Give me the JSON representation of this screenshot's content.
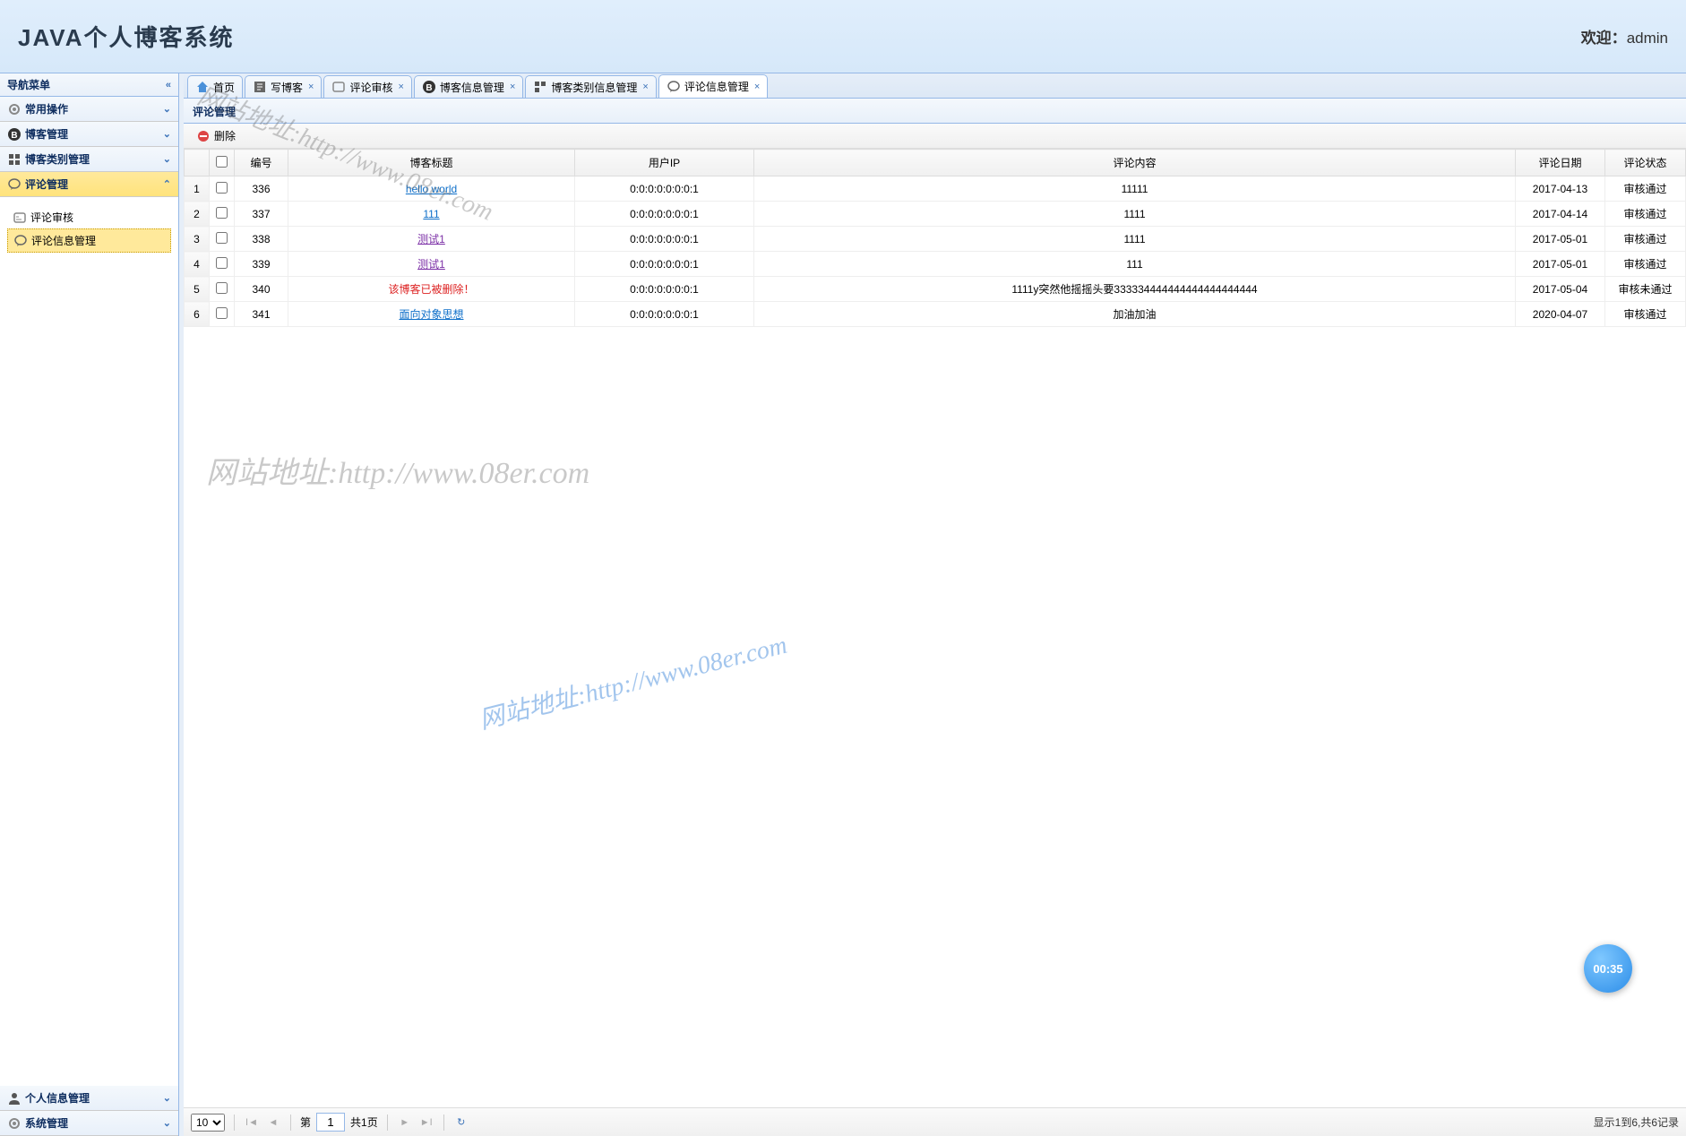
{
  "header": {
    "logo": "JAVA个人博客系统",
    "welcome_label": "欢迎：",
    "username": "admin"
  },
  "sidebar": {
    "title": "导航菜单",
    "sections": [
      {
        "label": "常用操作",
        "icon": "gear"
      },
      {
        "label": "博客管理",
        "icon": "blog"
      },
      {
        "label": "博客类别管理",
        "icon": "category"
      },
      {
        "label": "评论管理",
        "icon": "comment",
        "active": true
      },
      {
        "label": "个人信息管理",
        "icon": "user"
      },
      {
        "label": "系统管理",
        "icon": "settings"
      }
    ],
    "tree_items": [
      {
        "label": "评论审核",
        "icon": "review"
      },
      {
        "label": "评论信息管理",
        "icon": "comment",
        "selected": true
      }
    ]
  },
  "tabs": [
    {
      "label": "首页",
      "icon": "home",
      "closable": false
    },
    {
      "label": "写博客",
      "icon": "write",
      "closable": true
    },
    {
      "label": "评论审核",
      "icon": "review",
      "closable": true
    },
    {
      "label": "博客信息管理",
      "icon": "blog",
      "closable": true
    },
    {
      "label": "博客类别信息管理",
      "icon": "category",
      "closable": true
    },
    {
      "label": "评论信息管理",
      "icon": "comment",
      "closable": true,
      "active": true
    }
  ],
  "panel": {
    "title": "评论管理",
    "toolbar": {
      "delete_label": "删除"
    },
    "columns": [
      "编号",
      "博客标题",
      "用户IP",
      "评论内容",
      "评论日期",
      "评论状态"
    ],
    "rows": [
      {
        "num": "1",
        "id": "336",
        "title": "hello world",
        "title_class": "link-cell",
        "ip": "0:0:0:0:0:0:0:1",
        "content": "11111",
        "date": "2017-04-13",
        "status": "审核通过"
      },
      {
        "num": "2",
        "id": "337",
        "title": "111",
        "title_class": "link-cell",
        "ip": "0:0:0:0:0:0:0:1",
        "content": "1111",
        "date": "2017-04-14",
        "status": "审核通过"
      },
      {
        "num": "3",
        "id": "338",
        "title": "测试1",
        "title_class": "link-cell visited",
        "ip": "0:0:0:0:0:0:0:1",
        "content": "1111",
        "date": "2017-05-01",
        "status": "审核通过"
      },
      {
        "num": "4",
        "id": "339",
        "title": "测试1",
        "title_class": "link-cell visited",
        "ip": "0:0:0:0:0:0:0:1",
        "content": "111",
        "date": "2017-05-01",
        "status": "审核通过"
      },
      {
        "num": "5",
        "id": "340",
        "title": "该博客已被删除！",
        "title_class": "deleted",
        "ip": "0:0:0:0:0:0:0:1",
        "content": "1111y突然他摇摇头要333334444444444444444444",
        "date": "2017-05-04",
        "status": "审核未通过"
      },
      {
        "num": "6",
        "id": "341",
        "title": "面向对象思想",
        "title_class": "link-cell",
        "ip": "0:0:0:0:0:0:0:1",
        "content": "加油加油",
        "date": "2020-04-07",
        "status": "审核通过"
      }
    ]
  },
  "pager": {
    "page_size": "10",
    "page_label_prefix": "第",
    "current_page": "1",
    "page_label_suffix": "共1页",
    "info": "显示1到6,共6记录"
  },
  "watermarks": [
    "网站地址:http://www.08er.com",
    "网站地址:http://www.08er.com",
    "网站地址:http://www.08er.com"
  ],
  "badge": "00:35"
}
